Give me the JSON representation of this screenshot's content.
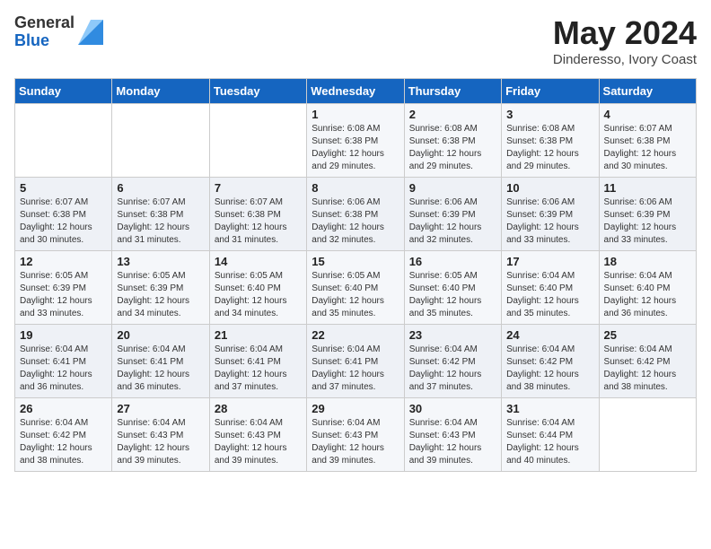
{
  "header": {
    "logo_general": "General",
    "logo_blue": "Blue",
    "month_title": "May 2024",
    "location": "Dinderesso, Ivory Coast"
  },
  "days_of_week": [
    "Sunday",
    "Monday",
    "Tuesday",
    "Wednesday",
    "Thursday",
    "Friday",
    "Saturday"
  ],
  "weeks": [
    [
      {
        "day": "",
        "sunrise": "",
        "sunset": "",
        "daylight": ""
      },
      {
        "day": "",
        "sunrise": "",
        "sunset": "",
        "daylight": ""
      },
      {
        "day": "",
        "sunrise": "",
        "sunset": "",
        "daylight": ""
      },
      {
        "day": "1",
        "sunrise": "Sunrise: 6:08 AM",
        "sunset": "Sunset: 6:38 PM",
        "daylight": "Daylight: 12 hours and 29 minutes."
      },
      {
        "day": "2",
        "sunrise": "Sunrise: 6:08 AM",
        "sunset": "Sunset: 6:38 PM",
        "daylight": "Daylight: 12 hours and 29 minutes."
      },
      {
        "day": "3",
        "sunrise": "Sunrise: 6:08 AM",
        "sunset": "Sunset: 6:38 PM",
        "daylight": "Daylight: 12 hours and 29 minutes."
      },
      {
        "day": "4",
        "sunrise": "Sunrise: 6:07 AM",
        "sunset": "Sunset: 6:38 PM",
        "daylight": "Daylight: 12 hours and 30 minutes."
      }
    ],
    [
      {
        "day": "5",
        "sunrise": "Sunrise: 6:07 AM",
        "sunset": "Sunset: 6:38 PM",
        "daylight": "Daylight: 12 hours and 30 minutes."
      },
      {
        "day": "6",
        "sunrise": "Sunrise: 6:07 AM",
        "sunset": "Sunset: 6:38 PM",
        "daylight": "Daylight: 12 hours and 31 minutes."
      },
      {
        "day": "7",
        "sunrise": "Sunrise: 6:07 AM",
        "sunset": "Sunset: 6:38 PM",
        "daylight": "Daylight: 12 hours and 31 minutes."
      },
      {
        "day": "8",
        "sunrise": "Sunrise: 6:06 AM",
        "sunset": "Sunset: 6:38 PM",
        "daylight": "Daylight: 12 hours and 32 minutes."
      },
      {
        "day": "9",
        "sunrise": "Sunrise: 6:06 AM",
        "sunset": "Sunset: 6:39 PM",
        "daylight": "Daylight: 12 hours and 32 minutes."
      },
      {
        "day": "10",
        "sunrise": "Sunrise: 6:06 AM",
        "sunset": "Sunset: 6:39 PM",
        "daylight": "Daylight: 12 hours and 33 minutes."
      },
      {
        "day": "11",
        "sunrise": "Sunrise: 6:06 AM",
        "sunset": "Sunset: 6:39 PM",
        "daylight": "Daylight: 12 hours and 33 minutes."
      }
    ],
    [
      {
        "day": "12",
        "sunrise": "Sunrise: 6:05 AM",
        "sunset": "Sunset: 6:39 PM",
        "daylight": "Daylight: 12 hours and 33 minutes."
      },
      {
        "day": "13",
        "sunrise": "Sunrise: 6:05 AM",
        "sunset": "Sunset: 6:39 PM",
        "daylight": "Daylight: 12 hours and 34 minutes."
      },
      {
        "day": "14",
        "sunrise": "Sunrise: 6:05 AM",
        "sunset": "Sunset: 6:40 PM",
        "daylight": "Daylight: 12 hours and 34 minutes."
      },
      {
        "day": "15",
        "sunrise": "Sunrise: 6:05 AM",
        "sunset": "Sunset: 6:40 PM",
        "daylight": "Daylight: 12 hours and 35 minutes."
      },
      {
        "day": "16",
        "sunrise": "Sunrise: 6:05 AM",
        "sunset": "Sunset: 6:40 PM",
        "daylight": "Daylight: 12 hours and 35 minutes."
      },
      {
        "day": "17",
        "sunrise": "Sunrise: 6:04 AM",
        "sunset": "Sunset: 6:40 PM",
        "daylight": "Daylight: 12 hours and 35 minutes."
      },
      {
        "day": "18",
        "sunrise": "Sunrise: 6:04 AM",
        "sunset": "Sunset: 6:40 PM",
        "daylight": "Daylight: 12 hours and 36 minutes."
      }
    ],
    [
      {
        "day": "19",
        "sunrise": "Sunrise: 6:04 AM",
        "sunset": "Sunset: 6:41 PM",
        "daylight": "Daylight: 12 hours and 36 minutes."
      },
      {
        "day": "20",
        "sunrise": "Sunrise: 6:04 AM",
        "sunset": "Sunset: 6:41 PM",
        "daylight": "Daylight: 12 hours and 36 minutes."
      },
      {
        "day": "21",
        "sunrise": "Sunrise: 6:04 AM",
        "sunset": "Sunset: 6:41 PM",
        "daylight": "Daylight: 12 hours and 37 minutes."
      },
      {
        "day": "22",
        "sunrise": "Sunrise: 6:04 AM",
        "sunset": "Sunset: 6:41 PM",
        "daylight": "Daylight: 12 hours and 37 minutes."
      },
      {
        "day": "23",
        "sunrise": "Sunrise: 6:04 AM",
        "sunset": "Sunset: 6:42 PM",
        "daylight": "Daylight: 12 hours and 37 minutes."
      },
      {
        "day": "24",
        "sunrise": "Sunrise: 6:04 AM",
        "sunset": "Sunset: 6:42 PM",
        "daylight": "Daylight: 12 hours and 38 minutes."
      },
      {
        "day": "25",
        "sunrise": "Sunrise: 6:04 AM",
        "sunset": "Sunset: 6:42 PM",
        "daylight": "Daylight: 12 hours and 38 minutes."
      }
    ],
    [
      {
        "day": "26",
        "sunrise": "Sunrise: 6:04 AM",
        "sunset": "Sunset: 6:42 PM",
        "daylight": "Daylight: 12 hours and 38 minutes."
      },
      {
        "day": "27",
        "sunrise": "Sunrise: 6:04 AM",
        "sunset": "Sunset: 6:43 PM",
        "daylight": "Daylight: 12 hours and 39 minutes."
      },
      {
        "day": "28",
        "sunrise": "Sunrise: 6:04 AM",
        "sunset": "Sunset: 6:43 PM",
        "daylight": "Daylight: 12 hours and 39 minutes."
      },
      {
        "day": "29",
        "sunrise": "Sunrise: 6:04 AM",
        "sunset": "Sunset: 6:43 PM",
        "daylight": "Daylight: 12 hours and 39 minutes."
      },
      {
        "day": "30",
        "sunrise": "Sunrise: 6:04 AM",
        "sunset": "Sunset: 6:43 PM",
        "daylight": "Daylight: 12 hours and 39 minutes."
      },
      {
        "day": "31",
        "sunrise": "Sunrise: 6:04 AM",
        "sunset": "Sunset: 6:44 PM",
        "daylight": "Daylight: 12 hours and 40 minutes."
      },
      {
        "day": "",
        "sunrise": "",
        "sunset": "",
        "daylight": ""
      }
    ]
  ]
}
